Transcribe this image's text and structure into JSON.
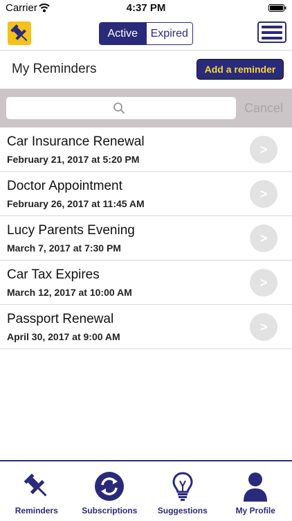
{
  "status": {
    "carrier": "Carrier",
    "time": "4:37 PM"
  },
  "nav": {
    "segments": [
      "Active",
      "Expired"
    ],
    "active_segment": "Active"
  },
  "header": {
    "title": "My Reminders",
    "add_button": "Add a reminder"
  },
  "search": {
    "placeholder": "",
    "cancel": "Cancel"
  },
  "reminders": [
    {
      "title": "Car Insurance Renewal",
      "date": "February 21, 2017 at 5:20 PM"
    },
    {
      "title": "Doctor Appointment",
      "date": "February 26, 2017 at 11:45 AM"
    },
    {
      "title": "Lucy Parents Evening",
      "date": "March 7, 2017 at 7:30 PM"
    },
    {
      "title": "Car Tax Expires",
      "date": "March 12, 2017 at 10:00 AM"
    },
    {
      "title": "Passport Renewal",
      "date": "April 30, 2017 at 9:00 AM"
    }
  ],
  "row_chevron": ">",
  "tabs": [
    {
      "label": "Reminders",
      "icon": "pushpin-icon"
    },
    {
      "label": "Subscriptions",
      "icon": "refresh-icon"
    },
    {
      "label": "Suggestions",
      "icon": "lightbulb-icon"
    },
    {
      "label": "My Profile",
      "icon": "person-icon"
    }
  ],
  "colors": {
    "brand": "#2a2a7a",
    "accent": "#f3c21c",
    "search_bg": "#cbc5c8"
  }
}
